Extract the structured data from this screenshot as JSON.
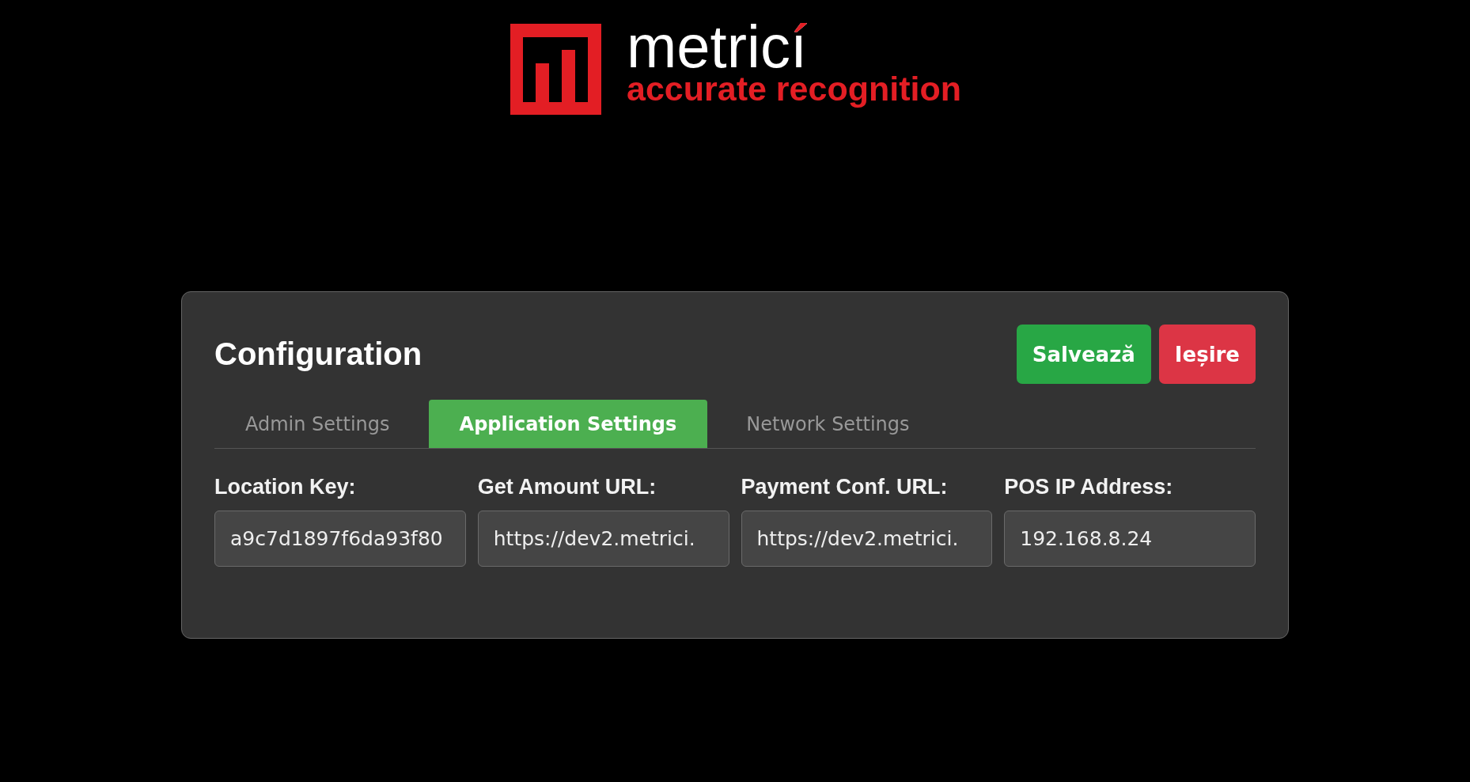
{
  "logo": {
    "wordmark": "metricí",
    "tagline": "accurate recognition"
  },
  "config": {
    "title": "Configuration",
    "buttons": [
      {
        "label": "Salvează",
        "kind": "save"
      },
      {
        "label": "Ieșire",
        "kind": "exit"
      }
    ],
    "tabs": [
      {
        "label": "Admin Settings",
        "selected": false
      },
      {
        "label": "Application Settings",
        "selected": true
      },
      {
        "label": "Network Settings",
        "selected": false
      }
    ],
    "fields": [
      {
        "label": "Location Key:",
        "value": "a9c7d1897f6da93f80"
      },
      {
        "label": "Get Amount URL:",
        "value": "https://dev2.metrici."
      },
      {
        "label": "Payment Conf. URL:",
        "value": "https://dev2.metrici."
      },
      {
        "label": "POS IP Address:",
        "value": "192.168.8.24"
      }
    ]
  }
}
